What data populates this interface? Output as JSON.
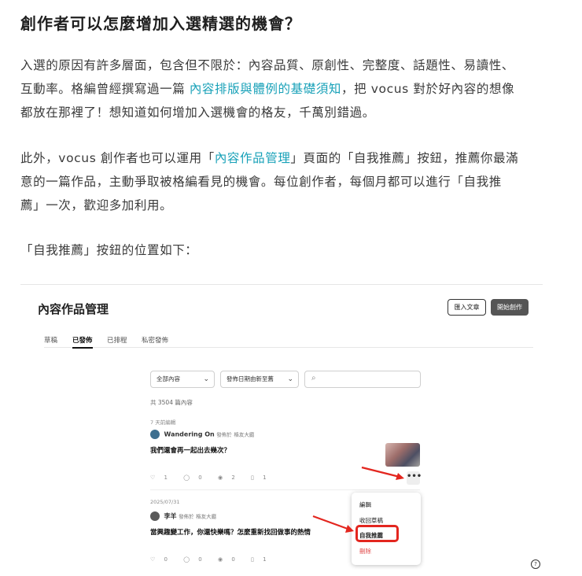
{
  "article": {
    "heading": "創作者可以怎麼增加入選精選的機會？",
    "p1": {
      "line1": "入選的原因有許多層面，包含但不限於：內容品質、原創性、完整度、話題性、易讀性、",
      "line2_before": "互動率。格編曾經撰寫過一篇 ",
      "line2_link": "內容排版與體例的基礎須知",
      "line2_after": "，把 vocus 對於好內容的想像",
      "line3": "都放在那裡了！想知道如何增加入選機會的格友，千萬別錯過。"
    },
    "p2": {
      "line1_before": "此外，vocus 創作者也可以運用「",
      "line1_link": "內容作品管理",
      "line1_after": "」頁面的「自我推薦」按鈕，推薦你最滿",
      "line2": "意的一篇作品，主動爭取被格編看見的機會。每位創作者，每個月都可以進行「自我推",
      "line3": "薦」一次，歡迎多加利用。"
    },
    "p3": "「自我推薦」按鈕的位置如下："
  },
  "screenshot": {
    "title": "內容作品管理",
    "import_button": "匯入文章",
    "create_button": "開始創作",
    "tabs": [
      "草稿",
      "已發佈",
      "已排程",
      "私密發佈"
    ],
    "active_tab": 1,
    "filter_content": "全部內容",
    "filter_sort": "發佈日期由新至舊",
    "total_count": "共 3504 篇內容",
    "posts": [
      {
        "time": "7 天前編輯",
        "author": "Wandering On",
        "published_in": "發佈於",
        "publication": "格友大廳",
        "title": "我們還會再一起出去幾次？",
        "likes": "1",
        "comments": "0",
        "views": "2",
        "saves": "1"
      },
      {
        "time": "2025/07/31",
        "author": "李羊",
        "published_in": "發佈於",
        "publication": "格友大廳",
        "title": "當興趣變工作，你還快樂嗎？怎麼重新找回做事的熱情",
        "likes": "0",
        "comments": "0",
        "views": "0",
        "saves": "1"
      }
    ],
    "menu_items": {
      "edit": "編輯",
      "revert": "收回草稿",
      "recommend": "自我推薦",
      "delete": "刪除"
    },
    "help": "?",
    "more": "•••"
  },
  "colors": {
    "link": "#18a1b8",
    "highlight": "#e3261f",
    "delete": "#e14a4a"
  }
}
